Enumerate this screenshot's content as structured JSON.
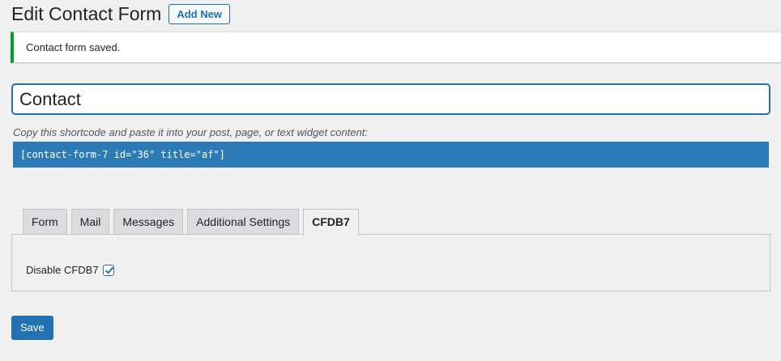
{
  "header": {
    "title": "Edit Contact Form",
    "add_new_label": "Add New"
  },
  "notice": {
    "text": "Contact form saved.",
    "color": "#00a32a"
  },
  "form_title": {
    "value": "Contact"
  },
  "shortcode": {
    "label": "Copy this shortcode and paste it into your post, page, or text widget content:",
    "value": "[contact-form-7 id=\"36\" title=\"af\"]"
  },
  "tabs": [
    {
      "label": "Form",
      "active": false
    },
    {
      "label": "Mail",
      "active": false
    },
    {
      "label": "Messages",
      "active": false
    },
    {
      "label": "Additional Settings",
      "active": false
    },
    {
      "label": "CFDB7",
      "active": true
    }
  ],
  "cfdb7_panel": {
    "disable_label": "Disable CFDB7",
    "disable_checked": true
  },
  "save_label": "Save",
  "accent_color": "#2271b1"
}
